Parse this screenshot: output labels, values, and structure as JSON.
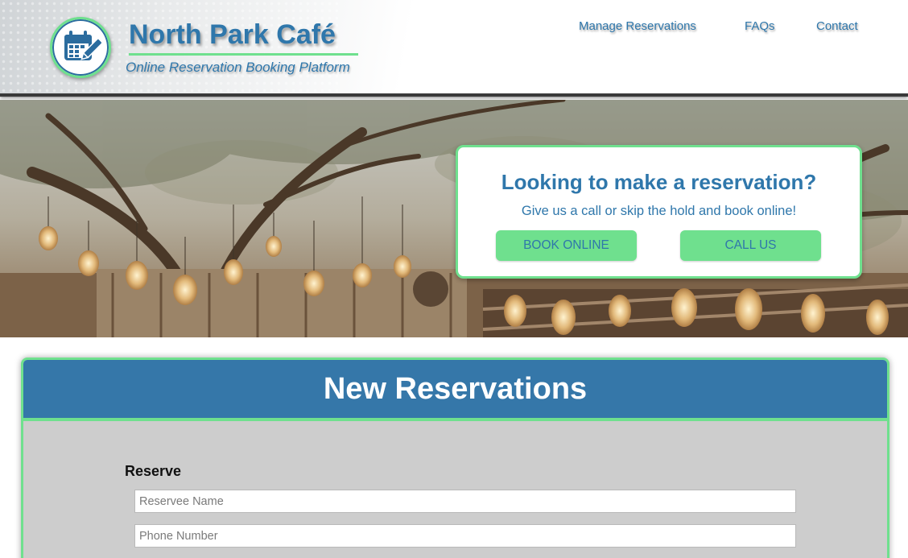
{
  "brand": {
    "title": "North Park Café",
    "subtitle": "Online Reservation Booking Platform",
    "logo_icon": "calendar-edit-icon"
  },
  "nav": {
    "items": [
      {
        "label": "Manage Reservations"
      },
      {
        "label": "FAQs"
      },
      {
        "label": "Contact"
      }
    ]
  },
  "hero": {
    "callout_title": "Looking to make a reservation?",
    "callout_subtitle": "Give us a call or skip the hold and book online!",
    "book_online_label": "BOOK ONLINE",
    "call_us_label": "CALL US"
  },
  "reservations": {
    "title": "New Reservations",
    "section_label": "Reserve",
    "name_placeholder": "Reservee Name",
    "phone_placeholder": "Phone Number"
  },
  "colors": {
    "brand_blue": "#2f77ab",
    "accent_green": "#6fe08e",
    "panel_header": "#3577a9",
    "panel_body": "#cdcdcd"
  }
}
